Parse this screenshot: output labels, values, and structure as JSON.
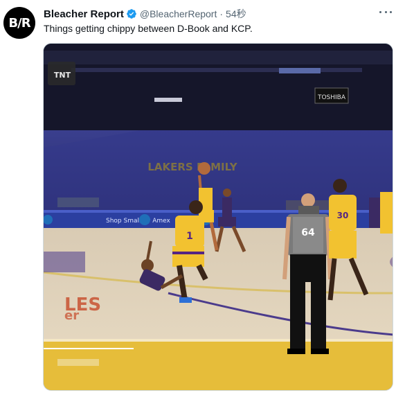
{
  "author": {
    "display_name": "Bleacher Report",
    "handle": "@BleacherReport",
    "time": "54秒",
    "avatar_text": "B/R",
    "verified": true
  },
  "tweet": {
    "text": "Things getting chippy between D-Book and KCP."
  },
  "video": {
    "network_logo": "TNT",
    "arena_sign_top": "TOSHIBA",
    "seat_text": "LAKERS FAMILY",
    "board_text": "Shop Small by Amex",
    "referee_number": "64",
    "player_numbers": [
      "1",
      "30"
    ],
    "court_text_1": "LES",
    "court_text_2": "er"
  },
  "colors": {
    "accent": "#1d9bf0",
    "laker_gold": "#f2c230",
    "laker_purple": "#552583",
    "suns_purple": "#3b2a63"
  },
  "icons": {
    "verified": "verified-badge-icon",
    "more": "more-dots-icon"
  }
}
